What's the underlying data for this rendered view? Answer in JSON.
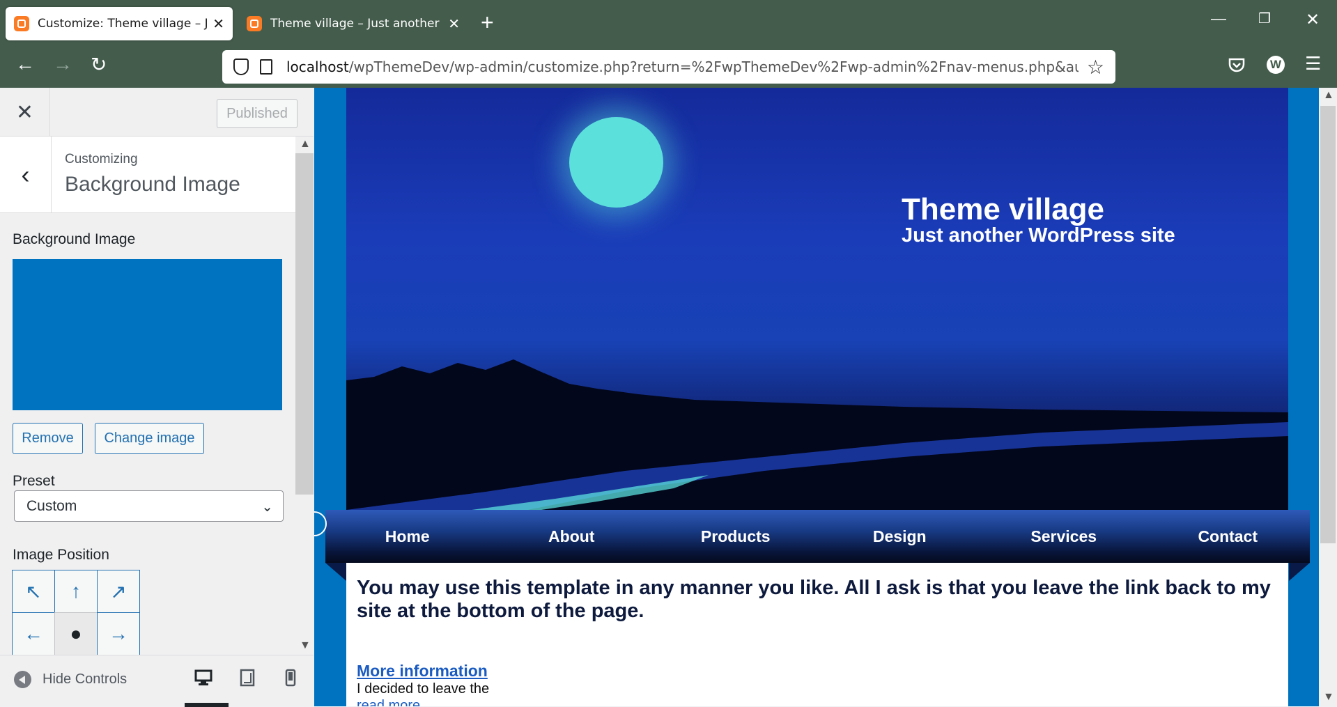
{
  "browser": {
    "tabs": [
      {
        "title": "Customize: Theme village – Just another WordPress site",
        "active": true
      },
      {
        "title": "Theme village – Just another WordPress site",
        "active": false
      }
    ],
    "url_host": "localhost",
    "url_path": "/wpThemeDev/wp-admin/customize.php?return=%2FwpThemeDev%2Fwp-admin%2Fnav-menus.php&autofocus[control]",
    "profile_initial": "W"
  },
  "customizer": {
    "published_label": "Published",
    "customizing_label": "Customizing",
    "section_title": "Background Image",
    "bg_image_label": "Background Image",
    "bg_color": "#0073c0",
    "remove_label": "Remove",
    "change_label": "Change image",
    "preset_label": "Preset",
    "preset_value": "Custom",
    "position_label": "Image Position",
    "hide_controls_label": "Hide Controls"
  },
  "preview": {
    "site_title": "Theme village",
    "tagline": "Just another WordPress site",
    "menu": [
      "Home",
      "About",
      "Products",
      "Design",
      "Services",
      "Contact"
    ],
    "headline": "You may use this template in any manner you like. All I ask is that you leave the link back to my site at the bottom of the page.",
    "more_info": "More information",
    "desc": "I decided to leave the",
    "read_more": "read more"
  }
}
